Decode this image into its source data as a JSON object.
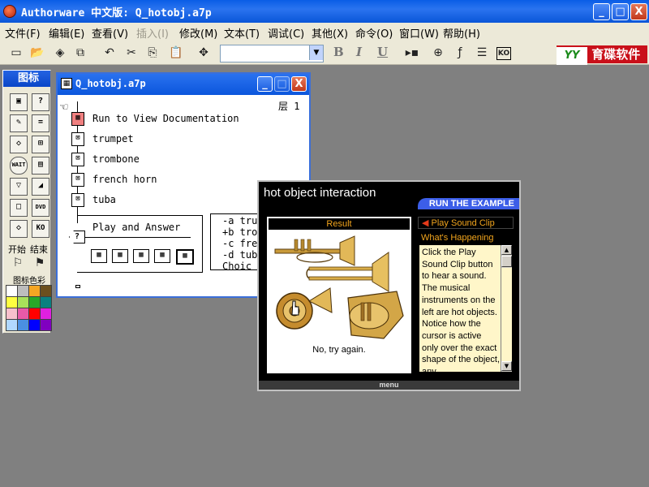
{
  "app": {
    "title": "Authorware 中文版: Q_hotobj.a7p"
  },
  "window_buttons": {
    "minimize": "_",
    "maximize": "□",
    "close": "X"
  },
  "menu": [
    {
      "label": "文件(F)",
      "disabled": false
    },
    {
      "label": "编辑(E)",
      "disabled": false
    },
    {
      "label": "查看(V)",
      "disabled": false
    },
    {
      "label": "插入(I)",
      "disabled": true
    },
    {
      "label": "修改(M)",
      "disabled": false
    },
    {
      "label": "文本(T)",
      "disabled": false
    },
    {
      "label": "调试(C)",
      "disabled": false
    },
    {
      "label": "其他(X)",
      "disabled": false
    },
    {
      "label": "命令(O)",
      "disabled": false
    },
    {
      "label": "窗口(W)",
      "disabled": false
    },
    {
      "label": "帮助(H)",
      "disabled": false
    }
  ],
  "toolbar": {
    "font_select_value": "",
    "bold": "B",
    "italic": "I",
    "underline": "U",
    "brand_logo": "YY",
    "brand_text": "育碟软件"
  },
  "palette": {
    "title": "图标",
    "start_label": "开始",
    "end_label": "结束",
    "color_label": "图标色彩",
    "icon_labels": [
      "WAIT",
      "DVD",
      "KO"
    ],
    "swatches": [
      "#ffffff",
      "#bdbdbd",
      "#f5a623",
      "#6b4f1e",
      "#ffff40",
      "#a8e05a",
      "#28a828",
      "#0a8080",
      "#f8c0cc",
      "#e85aa8",
      "#ff0000",
      "#e020e0",
      "#b0d8ff",
      "#4a90e2",
      "#0000ff",
      "#8000c0"
    ]
  },
  "flowline": {
    "title": "Q_hotobj.a7p",
    "level": "层 1",
    "items": [
      "Run to View Documentation",
      "trumpet",
      "trombone",
      "french horn",
      "tuba"
    ],
    "interaction_label": "Play and Answer",
    "responses": [
      "-a tru",
      "+b tro",
      "-c fre",
      "-d tub",
      " Choic"
    ]
  },
  "demo": {
    "title": "hot object interaction",
    "banner": "RUN THE EXAMPLE",
    "result_header": "Result",
    "result_message": "No, try again.",
    "play_button": "Play Sound Clip",
    "whats_header": "What's Happening",
    "whats_text": "Click the Play Sound Clip button to hear a sound. The musical instruments on the left are hot objects. Notice how the cursor is active only over the exact shape of the object, any",
    "menu_label": "menu",
    "colors": {
      "accent": "#f2a51d",
      "banner": "#3c5ee8"
    }
  }
}
